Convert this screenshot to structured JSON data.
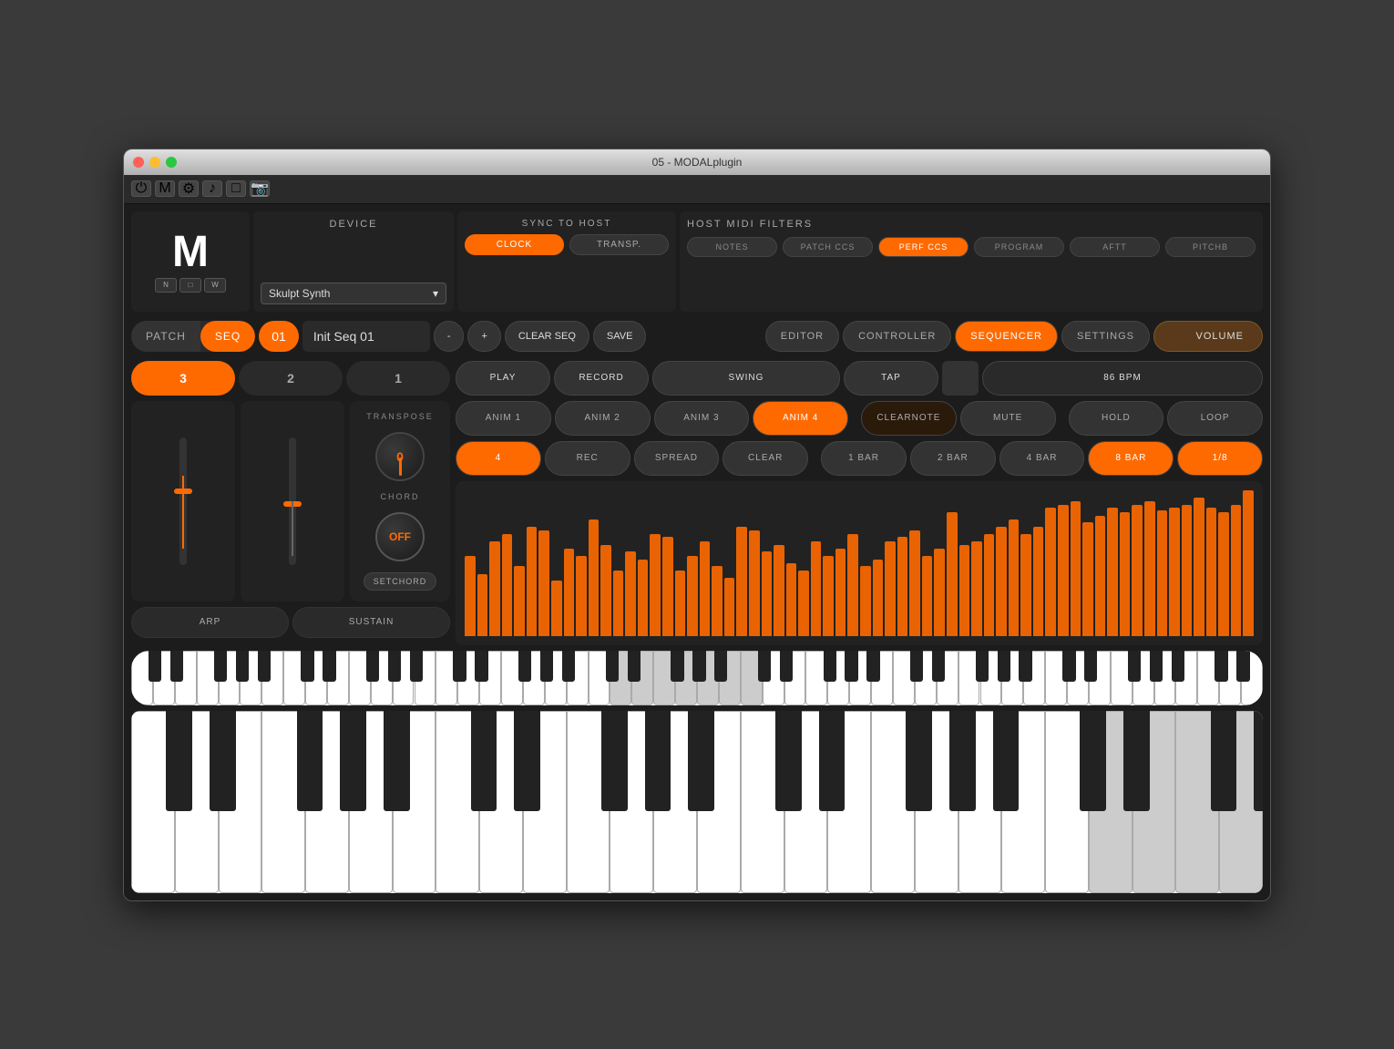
{
  "window": {
    "title": "05 - MODALplugin"
  },
  "header": {
    "device_label": "DEVICE",
    "device_name": "Skulpt Synth",
    "sync_label": "SYNC TO HOST",
    "clock_label": "CLOCK",
    "transp_label": "TRANSP.",
    "midi_filters_label": "HOST MIDI FILTERS",
    "notes_label": "NOTES",
    "patch_ccs_label": "PATCH CCs",
    "perf_ccs_label": "PERF CCs",
    "program_label": "PROGRAM",
    "aftt_label": "AFTT",
    "pitchb_label": "PITCHB"
  },
  "mode_bar": {
    "patch_label": "PATCH",
    "seq_label": "SEQ",
    "seq_number": "01",
    "seq_name": "Init Seq 01",
    "minus_label": "-",
    "plus_label": "+",
    "clear_seq_label": "CLEAR SEQ",
    "save_label": "SAVE",
    "editor_label": "EDITOR",
    "controller_label": "CONTROLLER",
    "sequencer_label": "SEQUENCER",
    "settings_label": "SETTINGS",
    "volume_label": "VOLUME"
  },
  "transport": {
    "play_label": "PLAY",
    "record_label": "RECORD",
    "swing_label": "SWING",
    "tap_label": "TAP",
    "bpm": "86 BPM"
  },
  "steps": {
    "step3": "3",
    "step2": "2",
    "step1": "1"
  },
  "anim": {
    "anim1": "ANIM 1",
    "anim2": "ANIM 2",
    "anim3": "ANIM 3",
    "anim4": "ANIM 4",
    "clearnote": "CLEARNOTE",
    "mute": "MUTE",
    "hold": "HOLD",
    "loop": "LOOP"
  },
  "seq_edit": {
    "step4": "4",
    "rec": "REC",
    "spread": "SPREAD",
    "clear": "CLEAR",
    "bar1": "1 BAR",
    "bar2": "2 BAR",
    "bar4": "4 BAR",
    "bar8": "8 BAR",
    "division": "1/8"
  },
  "knobs": {
    "transpose_label": "TRANSPOSE",
    "transpose_value": "0",
    "chord_label": "CHORD",
    "chord_value": "OFF",
    "setchord_label": "SETCHORD"
  },
  "bottom": {
    "arp_label": "ARP",
    "sustain_label": "SUSTAIN"
  },
  "sequencer_bars": [
    55,
    42,
    65,
    70,
    48,
    75,
    72,
    38,
    60,
    55,
    80,
    62,
    45,
    58,
    52,
    70,
    68,
    45,
    55,
    65,
    48,
    40,
    75,
    72,
    58,
    62,
    50,
    45,
    65,
    55,
    60,
    70,
    48,
    52,
    65,
    68,
    72,
    55,
    60,
    85,
    62,
    65,
    70,
    75,
    80,
    70,
    75,
    88,
    90,
    92,
    78,
    82,
    88,
    85,
    90,
    92,
    86,
    88,
    90,
    95,
    88,
    85,
    90,
    100
  ]
}
